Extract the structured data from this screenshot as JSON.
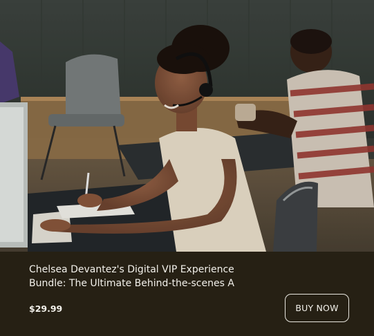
{
  "product": {
    "title": "Chelsea Devantez's Digital VIP Experience Bundle: The Ultimate Behind-the-scenes A",
    "price": "$29.99",
    "buy_label": "BUY NOW"
  },
  "image": {
    "alt": "Woman with headset working at computer desk in office"
  },
  "colors": {
    "background": "#262014",
    "text": "#f2f0ea",
    "button_border": "#e8e6df"
  }
}
